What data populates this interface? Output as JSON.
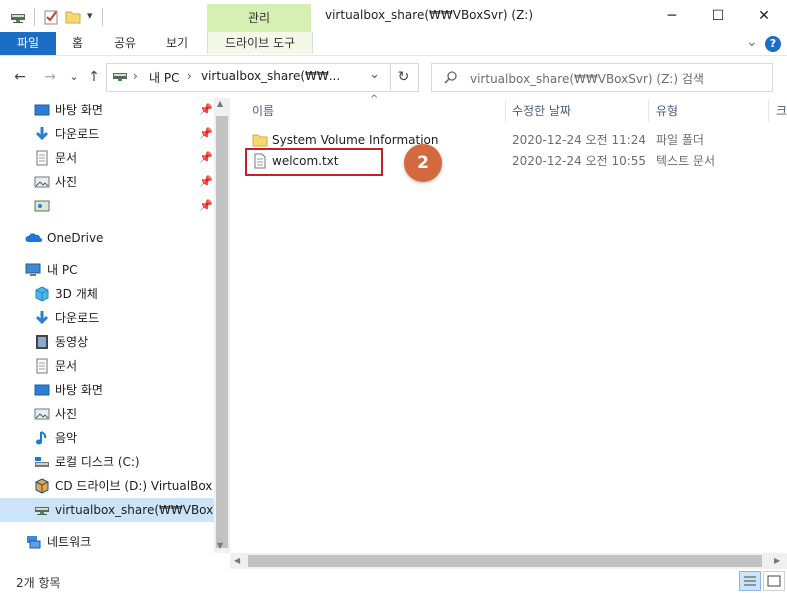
{
  "title_bar": {
    "manage_tab": "관리",
    "window_title": "virtualbox_share(₩₩VBoxSvr) (Z:)",
    "quick_access_dropdown": "▾",
    "minimize": "─",
    "maximize": "☐",
    "close": "✕"
  },
  "ribbon": {
    "tabs": [
      "파일",
      "홈",
      "공유",
      "보기"
    ],
    "drive_tools_tab": "드라이브 도구",
    "expand_chevron": "⌄",
    "help": "?"
  },
  "address": {
    "back": "←",
    "forward": "→",
    "recent": "⌄",
    "up": "↑",
    "path_parts": [
      "내 PC",
      "virtualbox_share(₩₩..."
    ],
    "separator": "›",
    "dropdown": "⌄",
    "refresh": "↻",
    "search_placeholder": "virtualbox_share(₩₩VBoxSvr) (Z:) 검색"
  },
  "nav_pane": {
    "quick_access": [
      {
        "label": "바탕 화면",
        "icon": "desktop-icon"
      },
      {
        "label": "다운로드",
        "icon": "download-icon"
      },
      {
        "label": "문서",
        "icon": "documents-icon"
      },
      {
        "label": "사진",
        "icon": "pictures-icon"
      },
      {
        "label": "",
        "icon": "image-folder-icon"
      }
    ],
    "onedrive": "OneDrive",
    "this_pc": "내 PC",
    "pc_items": [
      {
        "label": "3D 개체",
        "icon": "3d-objects-icon"
      },
      {
        "label": "다운로드",
        "icon": "download-icon"
      },
      {
        "label": "동영상",
        "icon": "videos-icon"
      },
      {
        "label": "문서",
        "icon": "documents-icon"
      },
      {
        "label": "바탕 화면",
        "icon": "desktop-icon"
      },
      {
        "label": "사진",
        "icon": "pictures-icon"
      },
      {
        "label": "음악",
        "icon": "music-icon"
      },
      {
        "label": "로컬 디스크 (C:)",
        "icon": "local-disk-icon"
      },
      {
        "label": "CD 드라이브 (D:) VirtualBox G",
        "icon": "cd-drive-icon"
      },
      {
        "label": "virtualbox_share(₩₩VBoxSvr)",
        "icon": "network-drive-icon"
      }
    ],
    "network": "네트워크"
  },
  "file_list": {
    "sort_indicator": "^",
    "columns": [
      "이름",
      "수정한 날짜",
      "유형",
      "크"
    ],
    "rows": [
      {
        "name": "System Volume Information",
        "date": "2020-12-24 오전 11:24",
        "type": "파일 폴더",
        "icon": "folder-icon"
      },
      {
        "name": "welcom.txt",
        "date": "2020-12-24 오전 10:55",
        "type": "텍스트 문서",
        "icon": "text-file-icon"
      }
    ]
  },
  "annotation": {
    "step_number": "2",
    "color": "#c8202a"
  },
  "status_bar": {
    "item_count": "2개 항목"
  },
  "colors": {
    "accent": "#1a6ec3",
    "manage_tab": "#d6efb3",
    "selected": "#cce4f7"
  }
}
